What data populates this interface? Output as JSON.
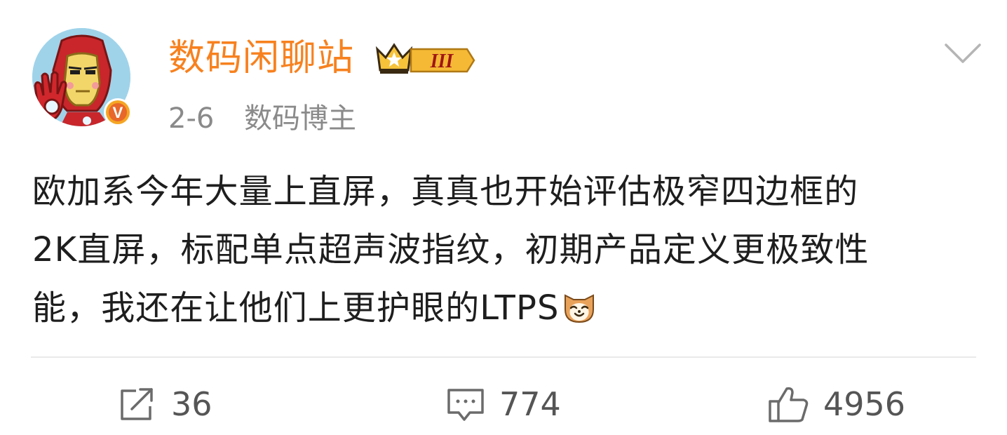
{
  "post": {
    "username": "数码闲聊站",
    "level_badge_text": "III",
    "date": "2-6",
    "tag": "数码博主",
    "verified_mark": "V",
    "content_lines": [
      "欧加系今年大量上直屏，真真也开始评估极窄四边框的",
      "2K直屏，标配单点超声波指纹，初期产品定义更极致性",
      "能，我还在让他们上更护眼的LTPS"
    ],
    "emoji": "cat-smile-emoji"
  },
  "actions": {
    "share_count": "36",
    "comment_count": "774",
    "like_count": "4956"
  },
  "colors": {
    "username": "#f7811e",
    "meta": "#8a8a8a",
    "text": "#1e1e1e",
    "icons": "#6b6b6b"
  }
}
